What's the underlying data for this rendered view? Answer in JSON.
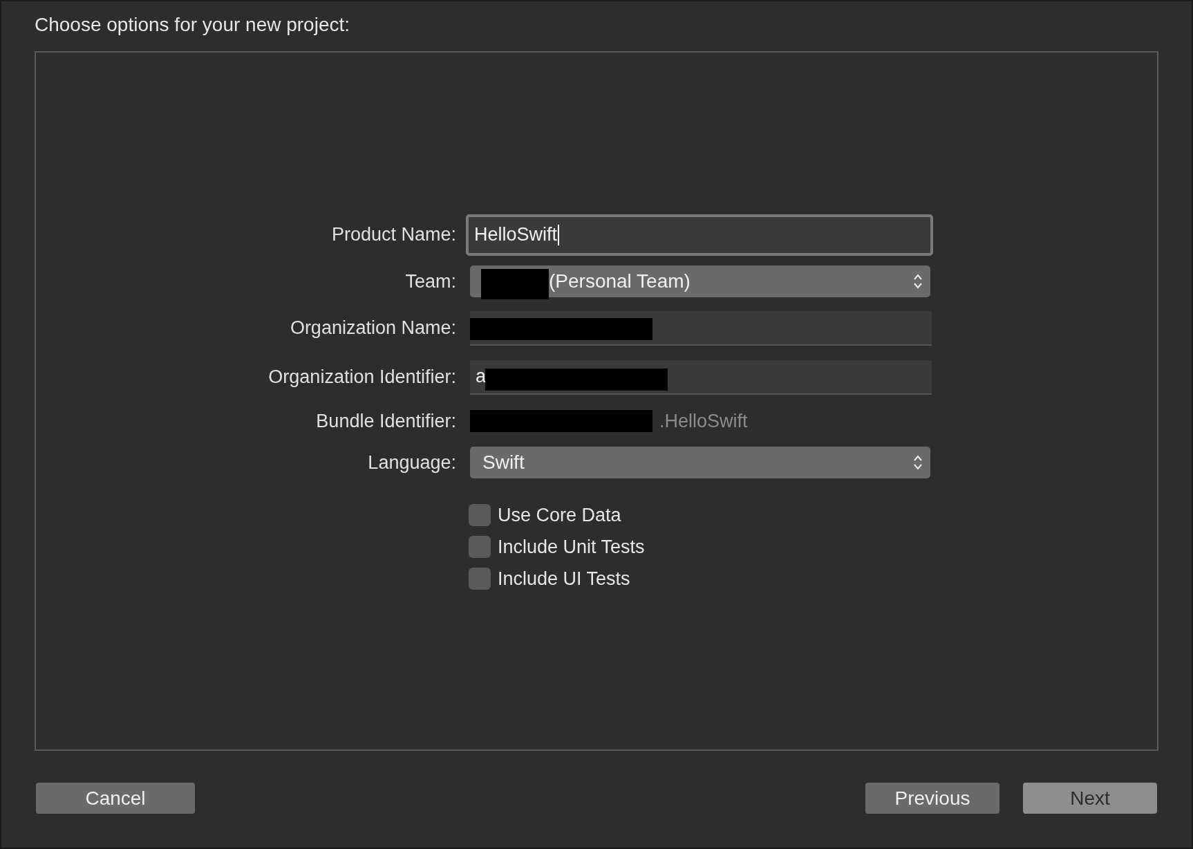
{
  "title": "Choose options for your new project:",
  "fields": [
    {
      "kind": "text",
      "label": "Product Name:",
      "value": "HelloSwift",
      "focused": true,
      "redacted": false
    },
    {
      "kind": "popup",
      "label": "Team:",
      "value": "(Personal Team)",
      "redacted": true
    },
    {
      "kind": "text",
      "label": "Organization Name:",
      "focused": false,
      "redacted": true
    },
    {
      "kind": "text",
      "label": "Organization Identifier:",
      "value": "a",
      "focused": false,
      "redacted": true
    },
    {
      "kind": "static",
      "label": "Bundle Identifier:",
      "value": ".HelloSwift",
      "redacted": true
    },
    {
      "kind": "popup",
      "label": "Language:",
      "value": "Swift",
      "redacted": false
    }
  ],
  "checkboxes": [
    {
      "label": "Use Core Data",
      "checked": false
    },
    {
      "label": "Include Unit Tests",
      "checked": false
    },
    {
      "label": "Include UI Tests",
      "checked": false
    }
  ],
  "buttons_left": [
    {
      "label": "Cancel",
      "kind": "normal"
    }
  ],
  "buttons_right": [
    {
      "label": "Previous",
      "kind": "normal"
    },
    {
      "label": "Next",
      "kind": "primary"
    }
  ]
}
